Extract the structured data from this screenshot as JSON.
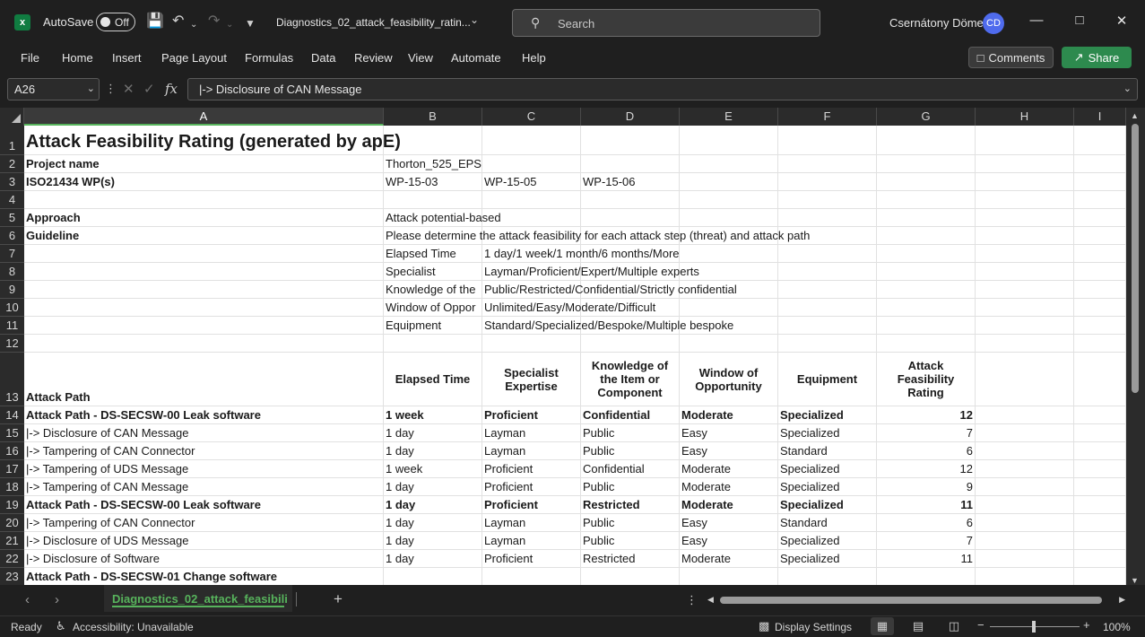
{
  "titlebar": {
    "autosave_label": "AutoSave",
    "autosave_state": "Off",
    "filename": "Diagnostics_02_attack_feasibility_ratin...",
    "search_placeholder": "Search",
    "user_name": "Csernátony Döme",
    "user_initials": "CD"
  },
  "menu": {
    "items": [
      "File",
      "Home",
      "Insert",
      "Page Layout",
      "Formulas",
      "Data",
      "Review",
      "View",
      "Automate",
      "Help"
    ],
    "comments_label": "Comments",
    "share_label": "Share"
  },
  "formula_bar": {
    "name_box": "A26",
    "formula": "|-> Disclosure of CAN Message",
    "fx": "fx"
  },
  "columns": [
    "A",
    "B",
    "C",
    "D",
    "E",
    "F",
    "G",
    "H",
    "I"
  ],
  "rows": [
    "1",
    "2",
    "3",
    "4",
    "5",
    "6",
    "7",
    "8",
    "9",
    "10",
    "11",
    "12",
    "13",
    "14",
    "15",
    "16",
    "17",
    "18",
    "19",
    "20",
    "21",
    "22",
    "23"
  ],
  "cells": {
    "title": "Attack Feasibility Rating (generated by apE)",
    "r2": {
      "a": "Project name",
      "b": "Thorton_525_EPS"
    },
    "r3": {
      "a": "ISO21434 WP(s)",
      "b": "WP-15-03",
      "c": "WP-15-05",
      "d": "WP-15-06"
    },
    "r5": {
      "a": "Approach",
      "b": "Attack potential-based"
    },
    "r6": {
      "a": "Guideline",
      "b": "Please determine the attack feasibility for each attack step (threat) and attack path"
    },
    "r7": {
      "b": "Elapsed Time",
      "c": "1 day/1 week/1 month/6 months/More"
    },
    "r8": {
      "b": "Specialist",
      "c": "Layman/Proficient/Expert/Multiple experts"
    },
    "r9": {
      "b": "Knowledge of the",
      "c": "Public/Restricted/Confidential/Strictly confidential"
    },
    "r10": {
      "b": "Window of Oppor",
      "c": "Unlimited/Easy/Moderate/Difficult"
    },
    "r11": {
      "b": "Equipment",
      "c": "Standard/Specialized/Bespoke/Multiple bespoke"
    },
    "header": {
      "a": "Attack Path",
      "b": "Elapsed Time",
      "c": "Specialist Expertise",
      "d": "Knowledge of the Item or Component",
      "e": "Window of Opportunity",
      "f": "Equipment",
      "g": "Attack Feasibility Rating"
    },
    "data": [
      {
        "a": "Attack Path - DS-SECSW-00 Leak software",
        "b": "1 week",
        "c": "Proficient",
        "d": "Confidential",
        "e": "Moderate",
        "f": "Specialized",
        "g": "12",
        "bold": true
      },
      {
        "a": "|-> Disclosure of CAN Message",
        "b": "1 day",
        "c": "Layman",
        "d": "Public",
        "e": "Easy",
        "f": "Specialized",
        "g": "7",
        "bold": false
      },
      {
        "a": "|-> Tampering of CAN Connector",
        "b": "1 day",
        "c": "Layman",
        "d": "Public",
        "e": "Easy",
        "f": "Standard",
        "g": "6",
        "bold": false
      },
      {
        "a": "|-> Tampering of UDS Message",
        "b": "1 week",
        "c": "Proficient",
        "d": "Confidential",
        "e": "Moderate",
        "f": "Specialized",
        "g": "12",
        "bold": false
      },
      {
        "a": "|-> Tampering of CAN Message",
        "b": "1 day",
        "c": "Proficient",
        "d": "Public",
        "e": "Moderate",
        "f": "Specialized",
        "g": "9",
        "bold": false
      },
      {
        "a": "Attack Path - DS-SECSW-00 Leak software",
        "b": "1 day",
        "c": "Proficient",
        "d": "Restricted",
        "e": "Moderate",
        "f": "Specialized",
        "g": "11",
        "bold": true
      },
      {
        "a": "|-> Tampering of CAN Connector",
        "b": "1 day",
        "c": "Layman",
        "d": "Public",
        "e": "Easy",
        "f": "Standard",
        "g": "6",
        "bold": false
      },
      {
        "a": "|-> Disclosure of UDS Message",
        "b": "1 day",
        "c": "Layman",
        "d": "Public",
        "e": "Easy",
        "f": "Specialized",
        "g": "7",
        "bold": false
      },
      {
        "a": "|-> Disclosure of Software",
        "b": "1 day",
        "c": "Proficient",
        "d": "Restricted",
        "e": "Moderate",
        "f": "Specialized",
        "g": "11",
        "bold": false
      },
      {
        "a": "Attack Path - DS-SECSW-01 Change software",
        "b": "",
        "c": "",
        "d": "",
        "e": "",
        "f": "",
        "g": "",
        "bold": true
      }
    ]
  },
  "sheet": {
    "tab_label": "Diagnostics_02_attack_feasibili",
    "add_label": "+"
  },
  "status": {
    "ready": "Ready",
    "accessibility": "Accessibility: Unavailable",
    "display_settings": "Display Settings",
    "zoom": "100%"
  }
}
